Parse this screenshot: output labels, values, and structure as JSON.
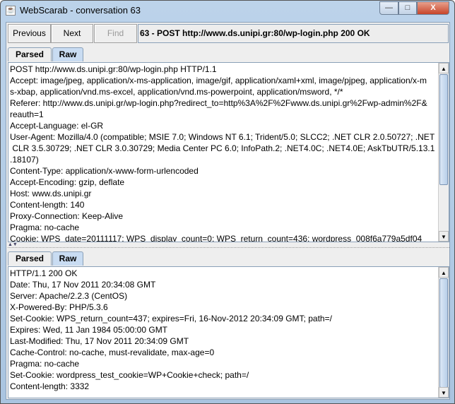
{
  "window": {
    "title": "WebScarab - conversation 63",
    "minimize": "—",
    "maximize": "□",
    "close": "X"
  },
  "toolbar": {
    "previous": "Previous",
    "next": "Next",
    "find": "Find",
    "summary": "63 - POST http://www.ds.unipi.gr:80/wp-login.php    200 OK"
  },
  "request": {
    "tabs": [
      "Parsed",
      "Raw"
    ],
    "selected_tab": "Raw",
    "lines": [
      "POST http://www.ds.unipi.gr:80/wp-login.php HTTP/1.1",
      "Accept: image/jpeg, application/x-ms-application, image/gif, application/xaml+xml, image/pjpeg, application/x-m",
      "s-xbap, application/vnd.ms-excel, application/vnd.ms-powerpoint, application/msword, */*",
      "Referer: http://www.ds.unipi.gr/wp-login.php?redirect_to=http%3A%2F%2Fwww.ds.unipi.gr%2Fwp-admin%2F&",
      "reauth=1",
      "Accept-Language: el-GR",
      "User-Agent: Mozilla/4.0 (compatible; MSIE 7.0; Windows NT 6.1; Trident/5.0; SLCC2; .NET CLR 2.0.50727; .NET",
      " CLR 3.5.30729; .NET CLR 3.0.30729; Media Center PC 6.0; InfoPath.2; .NET4.0C; .NET4.0E; AskTbUTR/5.13.1",
      ".18107)",
      "Content-Type: application/x-www-form-urlencoded",
      "Accept-Encoding: gzip, deflate",
      "Host: www.ds.unipi.gr",
      "Content-length: 140",
      "Proxy-Connection: Keep-Alive",
      "Pragma: no-cache",
      "Cookie: WPS_date=20111117; WPS_display_count=0; WPS_return_count=436; wordpress_008f6a779a5df04"
    ]
  },
  "divider": {
    "arrows": "▲▼"
  },
  "response": {
    "tabs": [
      "Parsed",
      "Raw"
    ],
    "selected_tab": "Raw",
    "lines": [
      "HTTP/1.1 200 OK",
      "Date: Thu, 17 Nov 2011 20:34:08 GMT",
      "Server: Apache/2.2.3 (CentOS)",
      "X-Powered-By: PHP/5.3.6",
      "Set-Cookie: WPS_return_count=437; expires=Fri, 16-Nov-2012 20:34:09 GMT; path=/",
      "Expires: Wed, 11 Jan 1984 05:00:00 GMT",
      "Last-Modified: Thu, 17 Nov 2011 20:34:09 GMT",
      "Cache-Control: no-cache, must-revalidate, max-age=0",
      "Pragma: no-cache",
      "Set-Cookie: wordpress_test_cookie=WP+Cookie+check; path=/",
      "Content-length: 3332"
    ]
  }
}
